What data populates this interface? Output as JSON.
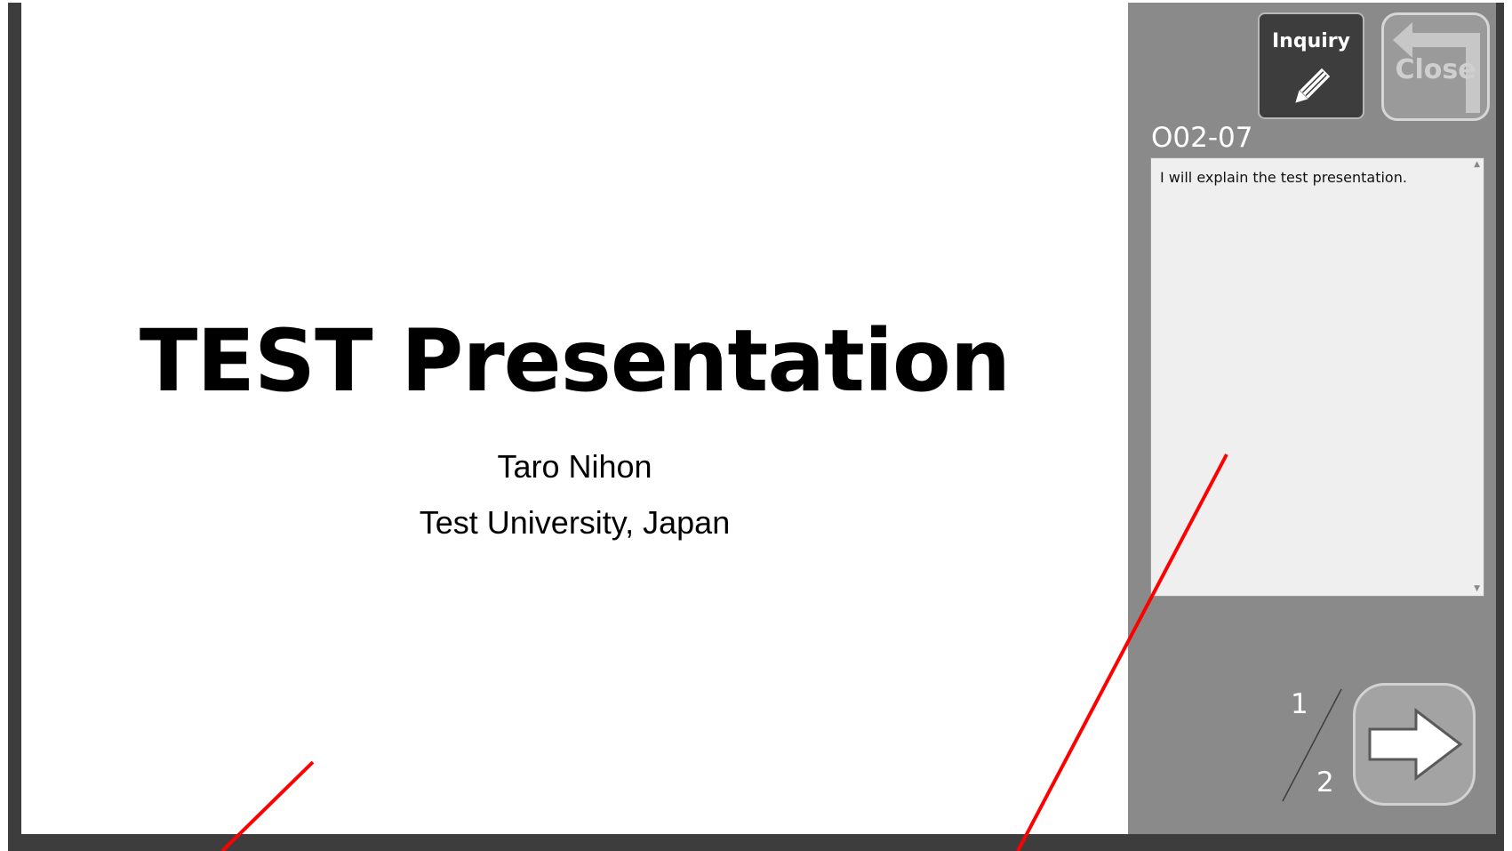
{
  "slide": {
    "title": "TEST Presentation",
    "author": "Taro Nihon",
    "affiliation": "Test University, Japan"
  },
  "panel": {
    "inquiry_label": "Inquiry",
    "close_label": "Close",
    "session_code": "O02-07",
    "notes_text": "I will explain the test presentation.",
    "page_current": "1",
    "page_total": "2"
  },
  "icons": {
    "inquiry": "pencil-icon",
    "close": "return-arrow-icon",
    "next": "right-arrow-icon"
  },
  "colors": {
    "frame": "#3d3d3d",
    "panel": "#8a8a8a",
    "inquiry_button": "#3d3d3d",
    "notes_background": "#efefef",
    "annotation": "#ff0000"
  }
}
